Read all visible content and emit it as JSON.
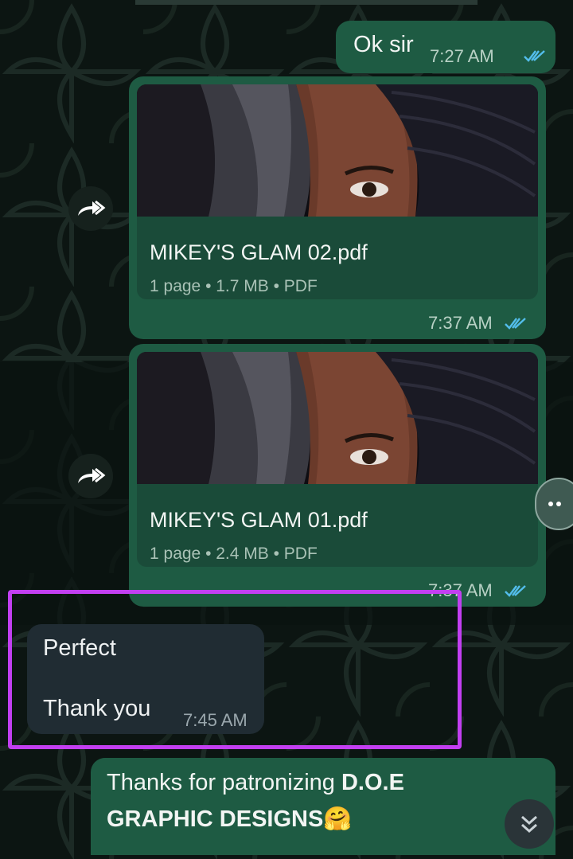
{
  "messages": {
    "ok_sir": {
      "text": "Ok sir",
      "time": "7:27 AM"
    },
    "doc1": {
      "filename": "MIKEY'S GLAM 02.pdf",
      "meta": "1 page • 1.7 MB • PDF",
      "time": "7:37 AM"
    },
    "doc2": {
      "filename": "MIKEY'S GLAM 01.pdf",
      "meta": "1 page • 2.4 MB • PDF",
      "time": "7:37 AM"
    },
    "incoming": {
      "line1": "Perfect",
      "line2": "Thank you",
      "time": "7:45 AM"
    },
    "thanks": {
      "prefix": "Thanks for patronizing ",
      "bold1": "D.O.E",
      "bold2": "GRAPHIC DESIGNS",
      "emoji": "🤗"
    }
  },
  "icons": {
    "forward": "forward-icon",
    "read_receipt": "double-check-icon",
    "scroll_down": "chevron-double-down-icon"
  },
  "colors": {
    "outgoing_bubble": "#1e5b43",
    "incoming_bubble": "#202c33",
    "read_tick": "#53bdeb",
    "highlight": "#c23ff1",
    "wallpaper": "#0b1411"
  }
}
